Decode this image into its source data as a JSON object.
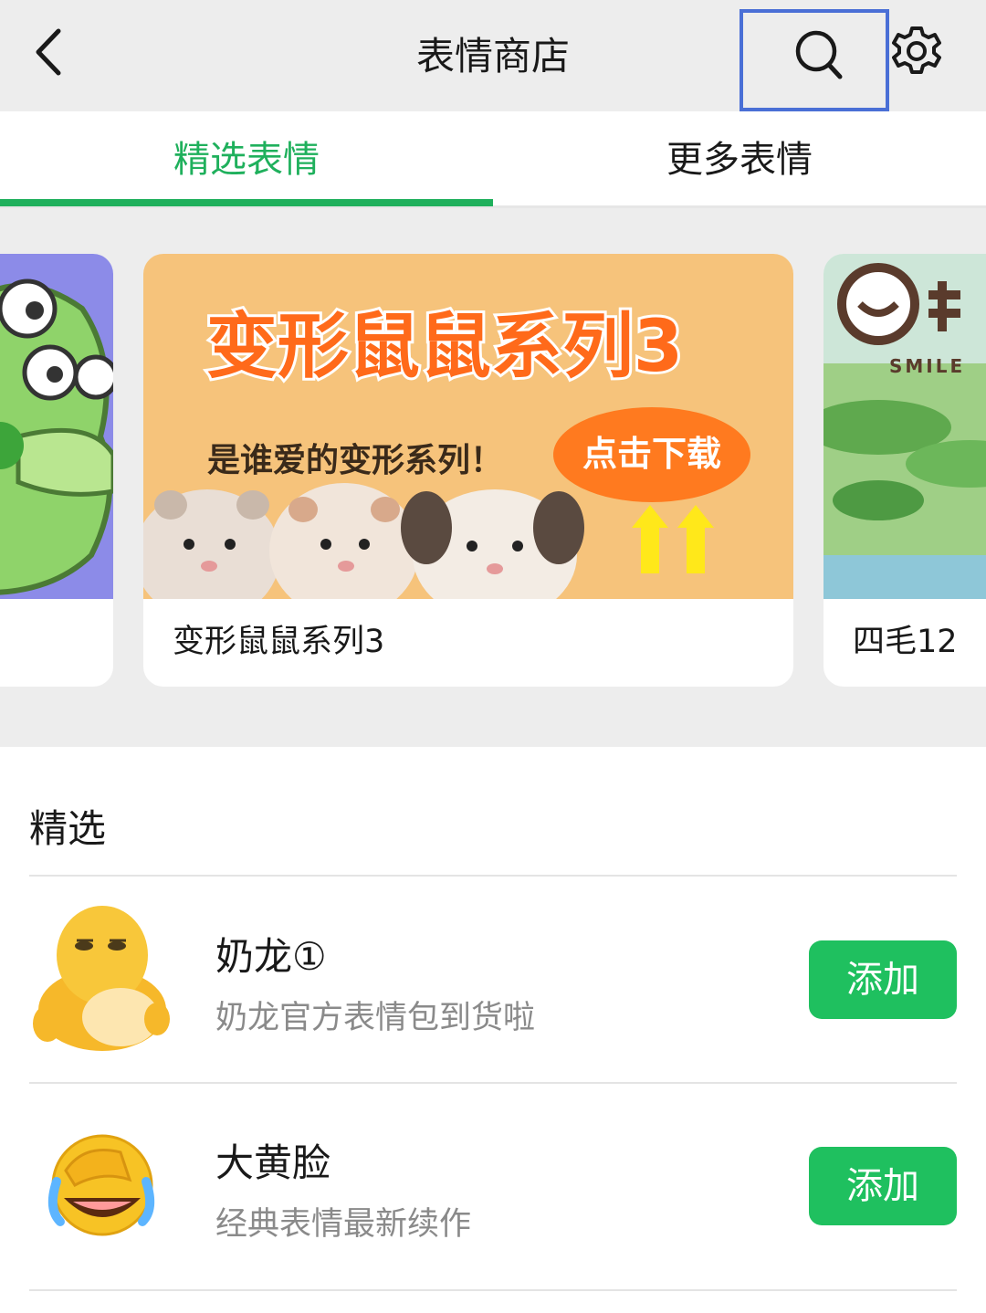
{
  "header": {
    "title": "表情商店"
  },
  "tabs": [
    {
      "label": "精选表情"
    },
    {
      "label": "更多表情"
    }
  ],
  "banner": {
    "cards": [
      {
        "label": ""
      },
      {
        "label": "变形鼠鼠系列3",
        "headline": "变形鼠鼠系列3",
        "tagline": "是谁爱的变形系列！",
        "cta": "点击下载"
      },
      {
        "label": "四毛12",
        "logo_text": "SMILE"
      }
    ]
  },
  "section": {
    "title": "精选"
  },
  "items": [
    {
      "name": "奶龙①",
      "desc": "奶龙官方表情包到货啦",
      "button": "添加"
    },
    {
      "name": "大黄脸",
      "desc": "经典表情最新续作",
      "button": "添加"
    }
  ],
  "colors": {
    "accent": "#1fb05c",
    "button": "#1fc05f",
    "header_bg": "#ededed",
    "search_highlight": "#4a6fd6"
  },
  "icons": [
    "back-arrow-icon",
    "search-icon",
    "gear-icon"
  ]
}
